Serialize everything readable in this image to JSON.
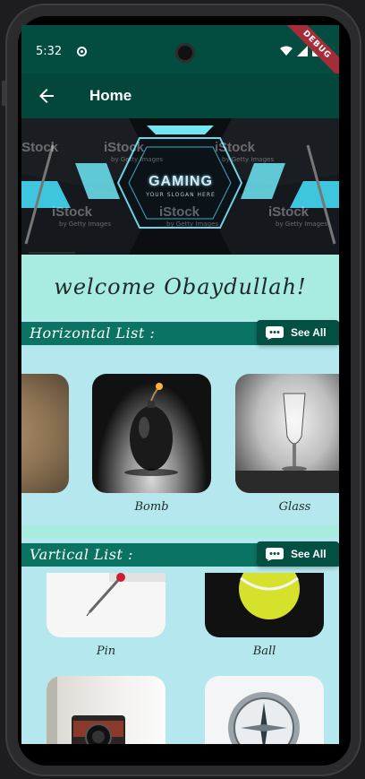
{
  "status_bar": {
    "time": "5:32",
    "debug_label": "DEBUG"
  },
  "app_bar": {
    "title": "Home",
    "back_icon": "arrow-left-icon"
  },
  "banner": {
    "logo_text": "GAMING",
    "slogan": "YOUR SLOGAN HERE",
    "watermarks": [
      "iStock",
      "iStock",
      "iStock",
      "iStock",
      "iStock",
      "iStock"
    ],
    "watermark_sub": "by Getty Images"
  },
  "welcome": {
    "text": "welcome Obaydullah!"
  },
  "horizontal_section": {
    "title": "Horizontal List :",
    "see_all_label": "See All",
    "items": [
      {
        "label": "",
        "image": "partial-face"
      },
      {
        "label": "Bomb",
        "image": "bomb"
      },
      {
        "label": "Glass",
        "image": "glass"
      }
    ]
  },
  "vertical_section": {
    "title": "Vartical List :",
    "see_all_label": "See All",
    "items": [
      {
        "label": "Pin",
        "image": "pin"
      },
      {
        "label": "Ball",
        "image": "tennis-ball"
      },
      {
        "label": "",
        "image": "camera"
      },
      {
        "label": "",
        "image": "compass"
      }
    ]
  },
  "colors": {
    "app_bar": "#02473a",
    "status_bar": "#024d3f",
    "section_header": "#0a7361",
    "see_all_button": "#025042",
    "welcome_bg": "#a7ecdf",
    "content_bg": "#b5e8ee"
  }
}
